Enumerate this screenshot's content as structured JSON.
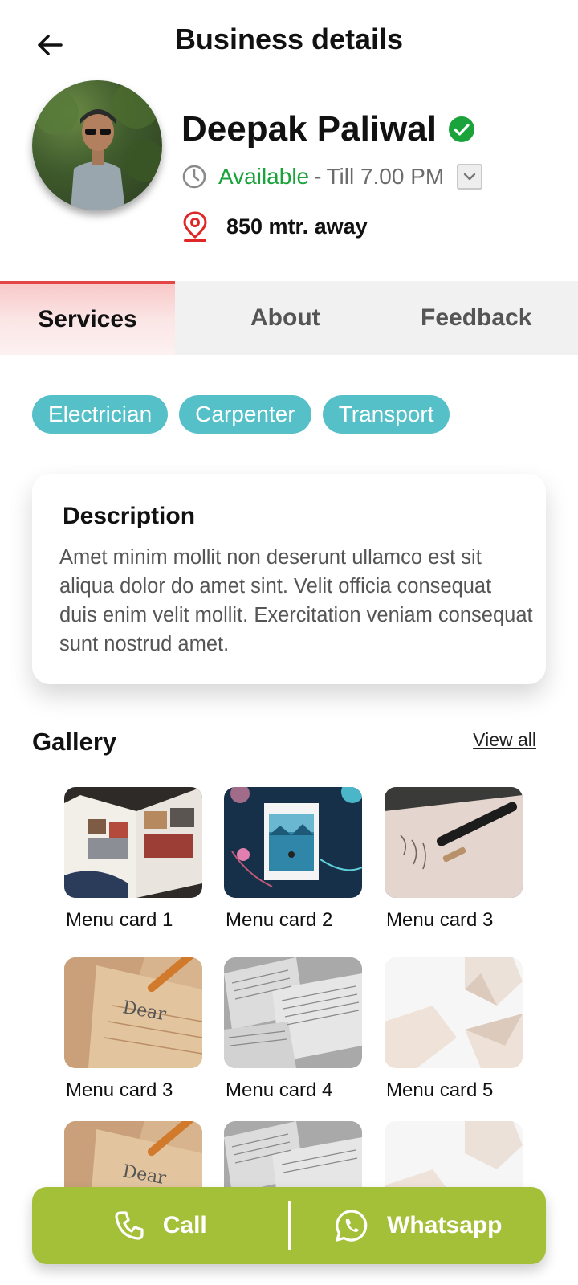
{
  "header": {
    "title": "Business details",
    "back_icon": "arrow-left-icon"
  },
  "profile": {
    "name": "Deepak Paliwal",
    "verified": true,
    "status_available": "Available",
    "status_separator": "-",
    "status_until": "Till 7.00 PM",
    "distance": "850 mtr. away"
  },
  "tabs": [
    {
      "label": "Services",
      "active": true
    },
    {
      "label": "About",
      "active": false
    },
    {
      "label": "Feedback",
      "active": false
    }
  ],
  "services": [
    "Electrician",
    "Carpenter",
    "Transport"
  ],
  "description": {
    "title": "Description",
    "body": "Amet minim mollit non deserunt ullamco est sit aliqua dolor do amet sint. Velit officia consequat duis enim velit mollit. Exercitation veniam consequat sunt nostrud amet."
  },
  "gallery": {
    "title": "Gallery",
    "view_all": "View all",
    "items": [
      {
        "label": "Menu card 1",
        "image": "magazine"
      },
      {
        "label": "Menu card 2",
        "image": "ocean-book"
      },
      {
        "label": "Menu card 3",
        "image": "fountain-pen"
      },
      {
        "label": "Menu card 3",
        "image": "kraft-letter"
      },
      {
        "label": "Menu card 4",
        "image": "open-books"
      },
      {
        "label": "Menu card 5",
        "image": "envelopes"
      },
      {
        "label": "",
        "image": "kraft-letter"
      },
      {
        "label": "",
        "image": "open-books"
      },
      {
        "label": "",
        "image": "envelopes"
      }
    ]
  },
  "actions": {
    "call": "Call",
    "whatsapp": "Whatsapp"
  },
  "colors": {
    "accent_red": "#e44545",
    "available_green": "#1aa33b",
    "chip_teal": "#55c0c8",
    "action_bar": "#a4c038"
  }
}
